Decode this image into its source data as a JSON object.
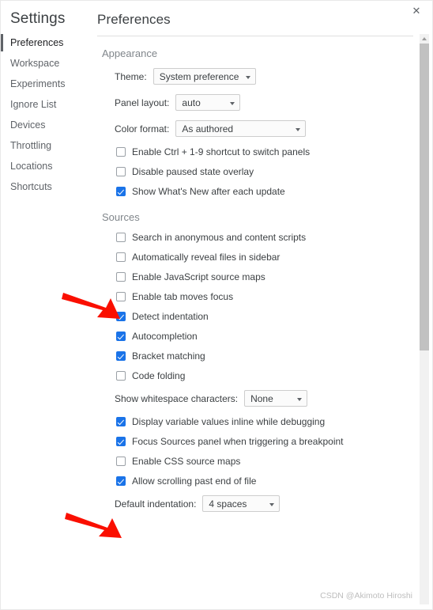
{
  "window": {
    "close_label": "✕"
  },
  "sidebar": {
    "title": "Settings",
    "items": [
      {
        "label": "Preferences",
        "selected": true
      },
      {
        "label": "Workspace",
        "selected": false
      },
      {
        "label": "Experiments",
        "selected": false
      },
      {
        "label": "Ignore List",
        "selected": false
      },
      {
        "label": "Devices",
        "selected": false
      },
      {
        "label": "Throttling",
        "selected": false
      },
      {
        "label": "Locations",
        "selected": false
      },
      {
        "label": "Shortcuts",
        "selected": false
      }
    ]
  },
  "main": {
    "page_title": "Preferences",
    "sections": [
      {
        "title": "Appearance",
        "selects": [
          {
            "label": "Theme:",
            "value": "System preference"
          },
          {
            "label": "Panel layout:",
            "value": "auto"
          },
          {
            "label": "Color format:",
            "value": "As authored"
          }
        ],
        "checkboxes": [
          {
            "label": "Enable Ctrl + 1-9 shortcut to switch panels",
            "checked": false
          },
          {
            "label": "Disable paused state overlay",
            "checked": false
          },
          {
            "label": "Show What's New after each update",
            "checked": true
          }
        ]
      },
      {
        "title": "Sources",
        "checkboxes_a": [
          {
            "label": "Search in anonymous and content scripts",
            "checked": false
          },
          {
            "label": "Automatically reveal files in sidebar",
            "checked": false
          },
          {
            "label": "Enable JavaScript source maps",
            "checked": false
          },
          {
            "label": "Enable tab moves focus",
            "checked": false
          },
          {
            "label": "Detect indentation",
            "checked": true
          },
          {
            "label": "Autocompletion",
            "checked": true
          },
          {
            "label": "Bracket matching",
            "checked": true
          },
          {
            "label": "Code folding",
            "checked": false
          }
        ],
        "whitespace_select": {
          "label": "Show whitespace characters:",
          "value": "None"
        },
        "checkboxes_b": [
          {
            "label": "Display variable values inline while debugging",
            "checked": true
          },
          {
            "label": "Focus Sources panel when triggering a breakpoint",
            "checked": true
          },
          {
            "label": "Enable CSS source maps",
            "checked": false
          },
          {
            "label": "Allow scrolling past end of file",
            "checked": true
          }
        ],
        "indent_select": {
          "label": "Default indentation:",
          "value": "4 spaces"
        }
      }
    ]
  },
  "annotations": {
    "arrow_color": "#fa0f00",
    "arrow_1_target": "Enable JavaScript source maps",
    "arrow_2_target": "Enable CSS source maps"
  },
  "watermark": {
    "text": "CSDN @Akimoto Hiroshi"
  },
  "colors": {
    "accent_blue": "#1a73e8",
    "arrow_red": "#fa0f00",
    "text_primary": "#3c4043",
    "text_muted": "#80868b",
    "scrollbar_thumb": "#c1c1c1"
  }
}
